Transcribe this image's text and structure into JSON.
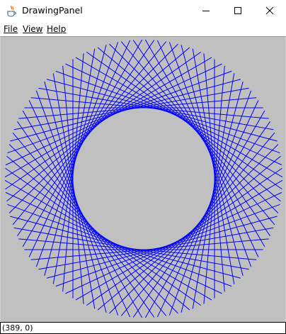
{
  "window": {
    "title": "DrawingPanel",
    "controls": {
      "minimize_icon": "minimize-icon",
      "maximize_icon": "maximize-icon",
      "close_icon": "close-icon"
    }
  },
  "menubar": {
    "items": [
      {
        "label": "File"
      },
      {
        "label": "View"
      },
      {
        "label": "Help"
      }
    ]
  },
  "canvas": {
    "background_color": "#c0c0c0",
    "line_color": "#0000ff"
  },
  "status": {
    "text": "(389, 0)"
  }
}
